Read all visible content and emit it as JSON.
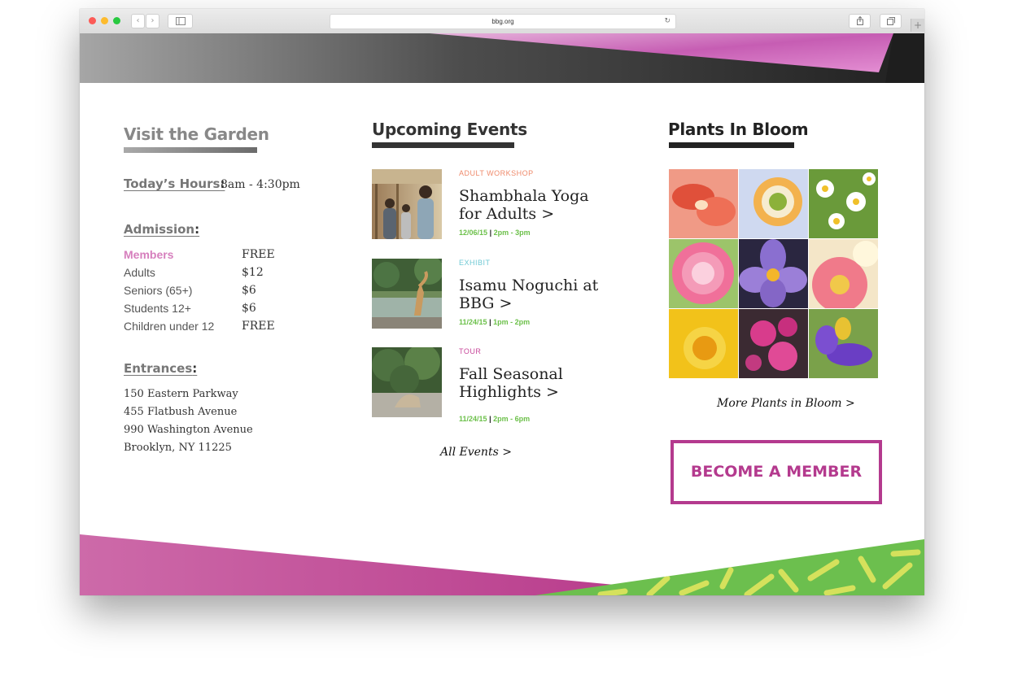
{
  "browser": {
    "url": "bbg.org",
    "back_glyph": "‹",
    "forward_glyph": "›",
    "reload_glyph": "↻",
    "new_tab_glyph": "+"
  },
  "colors": {
    "accent_magenta": "#b43a8e",
    "date_green": "#6cc04a",
    "cat_workshop": "#ef8a6b",
    "cat_exhibit": "#6fc9d4",
    "cat_tour": "#c8489b",
    "members_pink": "#d67fbd"
  },
  "visit": {
    "title": "Visit the Garden",
    "hours_label": "Today’s Hours",
    "colon": ":",
    "hours_value": "8am - 4:30pm",
    "admission_label": "Admission",
    "admission": [
      {
        "name": "Members",
        "price": "FREE"
      },
      {
        "name": "Adults",
        "price": "$12"
      },
      {
        "name": "Seniors (65+)",
        "price": "$6"
      },
      {
        "name": "Students 12+",
        "price": "$6"
      },
      {
        "name": "Children under 12",
        "price": "FREE"
      }
    ],
    "entrances_label": "Entrances",
    "entrances": [
      "150 Eastern Parkway",
      "455 Flatbush Avenue",
      "990 Washington Avenue",
      "Brooklyn, NY 11225"
    ]
  },
  "events": {
    "title": "Upcoming Events",
    "items": [
      {
        "category": "ADULT WORKSHOP",
        "title": "Shambhala Yoga for Adults >",
        "date": "12/06/15",
        "sep": "|",
        "time": "2pm - 3pm"
      },
      {
        "category": "EXHIBIT",
        "title": "Isamu Noguchi at BBG >",
        "date": "11/24/15",
        "sep": "|",
        "time": "1pm - 2pm"
      },
      {
        "category": "TOUR",
        "title": "Fall Seasonal Highlights >",
        "date": "11/24/15",
        "sep": "|",
        "time": "2pm - 6pm"
      }
    ],
    "all_link": "All Events >"
  },
  "bloom": {
    "title": "Plants In Bloom",
    "more_link": "More Plants in Bloom >",
    "member_button": "BECOME A MEMBER"
  }
}
